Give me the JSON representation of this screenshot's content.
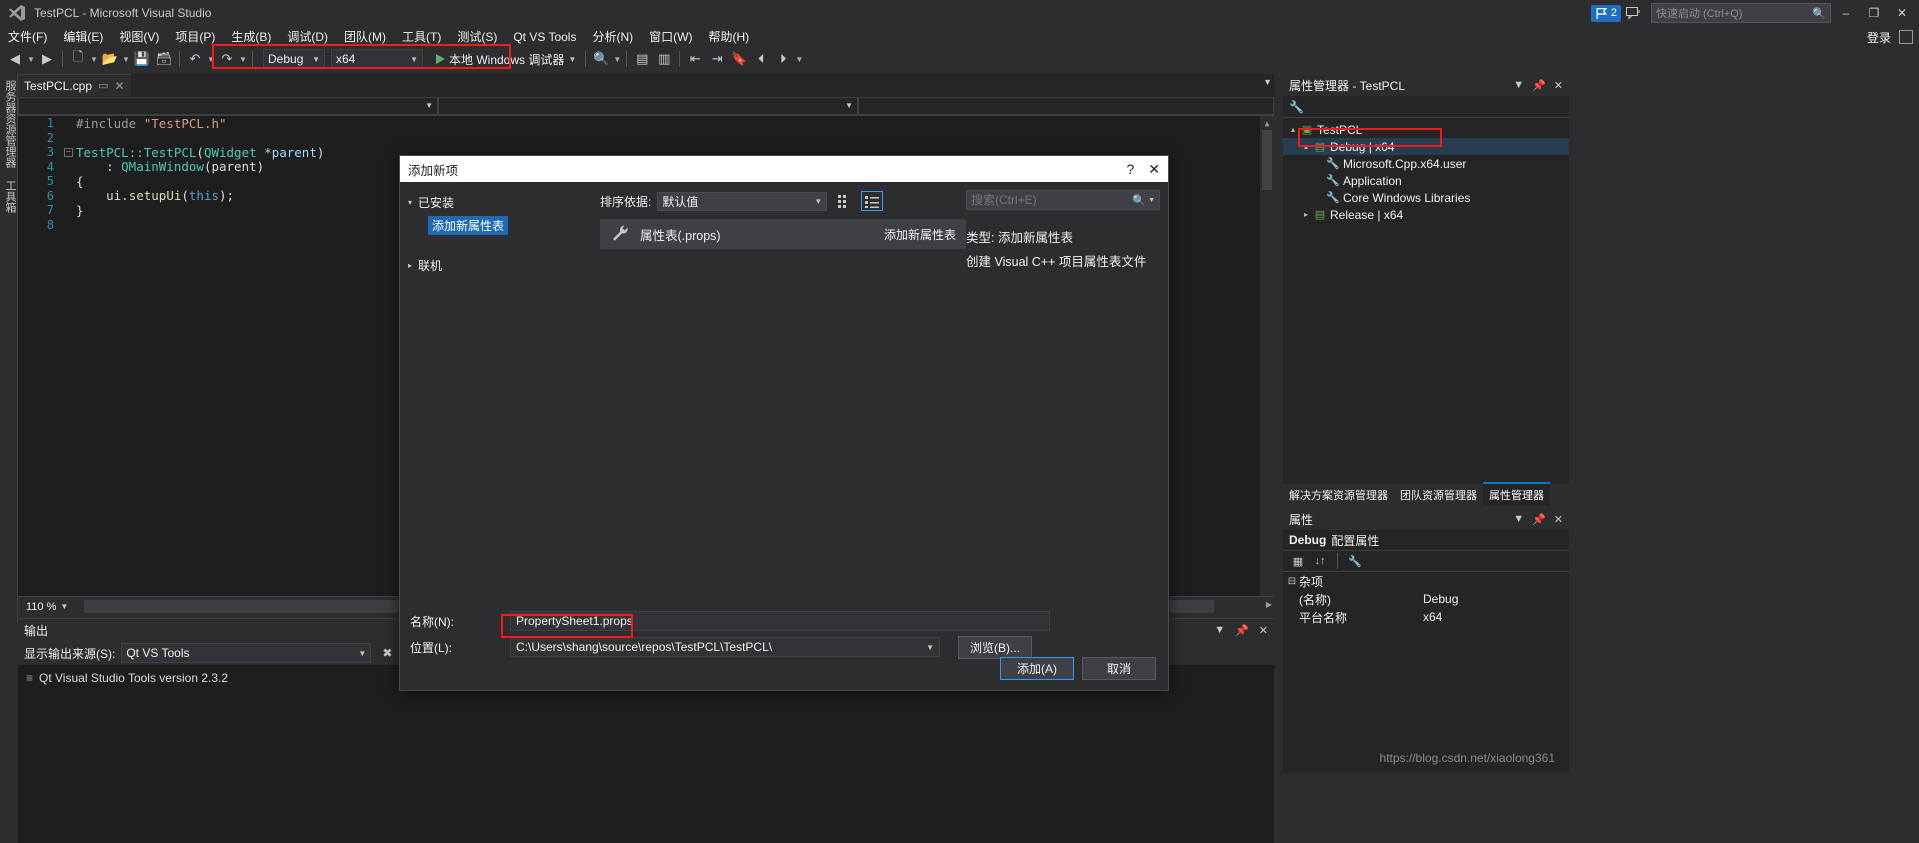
{
  "window": {
    "title": "TestPCL - Microsoft Visual Studio",
    "logo_icon": "visual-studio-logo",
    "notification_count": "2",
    "quick_launch_placeholder": "快速启动 (Ctrl+Q)",
    "login_label": "登录",
    "minimize": "–",
    "maximize": "❐",
    "close": "✕"
  },
  "menu": {
    "items": [
      {
        "label": "文件(F)"
      },
      {
        "label": "编辑(E)"
      },
      {
        "label": "视图(V)"
      },
      {
        "label": "项目(P)"
      },
      {
        "label": "生成(B)"
      },
      {
        "label": "调试(D)"
      },
      {
        "label": "团队(M)"
      },
      {
        "label": "工具(T)"
      },
      {
        "label": "测试(S)"
      },
      {
        "label": "Qt VS Tools"
      },
      {
        "label": "分析(N)"
      },
      {
        "label": "窗口(W)"
      },
      {
        "label": "帮助(H)"
      }
    ]
  },
  "toolbar": {
    "config": "Debug",
    "platform": "x64",
    "run_label": "本地 Windows 调试器",
    "highlight_color": "#ef1c1c"
  },
  "left_dock": {
    "tabs": [
      "服务器资源管理器",
      "工具箱"
    ]
  },
  "editor": {
    "tab_label": "TestPCL.cpp",
    "tab_pin": "▭",
    "tab_close": "✕",
    "zoom_level": "110 %",
    "lines": [
      {
        "n": "1",
        "fold": "",
        "tokens": [
          {
            "t": "#include ",
            "c": "c-pp"
          },
          {
            "t": "\"TestPCL.h\"",
            "c": "c-str"
          }
        ]
      },
      {
        "n": "2",
        "fold": "",
        "tokens": []
      },
      {
        "n": "3",
        "fold": "−",
        "tokens": [
          {
            "t": "TestPCL::TestPCL",
            "c": "c-type"
          },
          {
            "t": "(",
            "c": "c-id"
          },
          {
            "t": "QWidget ",
            "c": "c-type"
          },
          {
            "t": "*parent",
            "c": "c-var"
          },
          {
            "t": ")",
            "c": "c-id"
          }
        ]
      },
      {
        "n": "4",
        "fold": "",
        "tokens": [
          {
            "t": "    : ",
            "c": "c-id"
          },
          {
            "t": "QMainWindow",
            "c": "c-type"
          },
          {
            "t": "(parent)",
            "c": "c-id"
          }
        ]
      },
      {
        "n": "5",
        "fold": "",
        "tokens": [
          {
            "t": "{",
            "c": "c-id"
          }
        ]
      },
      {
        "n": "6",
        "fold": "",
        "tokens": [
          {
            "t": "    ui.",
            "c": "c-id"
          },
          {
            "t": "setupUi",
            "c": "c-fn"
          },
          {
            "t": "(",
            "c": "c-id"
          },
          {
            "t": "this",
            "c": "c-kw"
          },
          {
            "t": ");",
            "c": "c-id"
          }
        ]
      },
      {
        "n": "7",
        "fold": "",
        "tokens": [
          {
            "t": "}",
            "c": "c-id"
          }
        ]
      },
      {
        "n": "8",
        "fold": "",
        "tokens": []
      }
    ]
  },
  "output": {
    "title": "输出",
    "source_label": "显示输出来源(S):",
    "source_value": "Qt VS Tools",
    "lines": [
      "Qt Visual Studio Tools version 2.3.2"
    ]
  },
  "property_manager": {
    "title": "属性管理器 - TestPCL",
    "wrench_icon": "wrench-icon",
    "tree": [
      {
        "depth": 0,
        "arrow": "▴",
        "icon": "▣",
        "label": "TestPCL",
        "selected": false
      },
      {
        "depth": 1,
        "arrow": "▴",
        "icon": "▤",
        "label": "Debug | x64",
        "selected": true,
        "highlight": true
      },
      {
        "depth": 2,
        "arrow": "",
        "icon": "🔧",
        "label": "Microsoft.Cpp.x64.user",
        "selected": false
      },
      {
        "depth": 2,
        "arrow": "",
        "icon": "🔧",
        "label": "Application",
        "selected": false
      },
      {
        "depth": 2,
        "arrow": "",
        "icon": "🔧",
        "label": "Core Windows Libraries",
        "selected": false
      },
      {
        "depth": 1,
        "arrow": "▸",
        "icon": "▤",
        "label": "Release | x64",
        "selected": false
      }
    ],
    "tabs": [
      {
        "label": "解决方案资源管理器",
        "active": false
      },
      {
        "label": "团队资源管理器",
        "active": false
      },
      {
        "label": "属性管理器",
        "active": true
      }
    ]
  },
  "properties": {
    "title": "属性",
    "object_name": "Debug",
    "object_type": "配置属性",
    "group": "杂项",
    "rows": [
      {
        "key": "(名称)",
        "value": "Debug"
      },
      {
        "key": "平台名称",
        "value": "x64"
      }
    ]
  },
  "dialog": {
    "title": "添加新项",
    "help_icon": "question-mark-icon",
    "close_icon": "close-icon",
    "installed_group": "已安装",
    "installed_selected": "添加新属性表",
    "online_group": "联机",
    "sort_label": "排序依据:",
    "sort_value": "默认值",
    "view_grid_icon": "grid-view-icon",
    "view_list_icon": "list-view-icon",
    "search_placeholder": "搜索(Ctrl+E)",
    "search_icon": "search-icon",
    "items": [
      {
        "icon": "wrench-icon",
        "name": "属性表(.props)",
        "tag": "添加新属性表"
      }
    ],
    "detail_type_label": "类型:",
    "detail_type_value": "添加新属性表",
    "detail_description": "创建 Visual C++ 项目属性表文件",
    "name_label": "名称(N):",
    "name_value": "PropertySheet1.props",
    "location_label": "位置(L):",
    "location_value": "C:\\Users\\shang\\source\\repos\\TestPCL\\TestPCL\\",
    "browse_label": "浏览(B)...",
    "add_label": "添加(A)",
    "cancel_label": "取消",
    "highlight_color": "#ef1c1c"
  },
  "watermark": "https://blog.csdn.net/xiaolong361"
}
